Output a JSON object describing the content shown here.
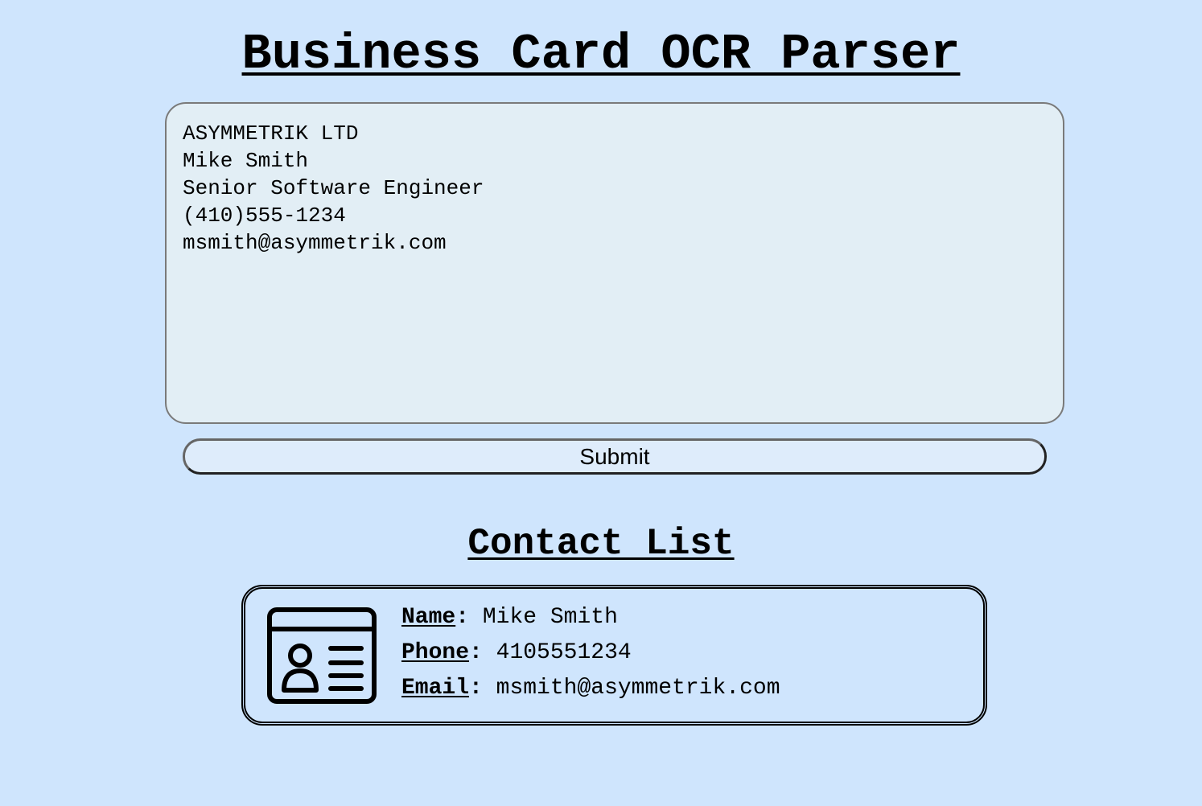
{
  "header": {
    "title": "Business Card OCR Parser"
  },
  "ocr_input": {
    "value": "ASYMMETRIK LTD\nMike Smith\nSenior Software Engineer\n(410)555-1234\nmsmith@asymmetrik.com"
  },
  "submit": {
    "label": "Submit"
  },
  "contacts": {
    "title": "Contact List",
    "items": [
      {
        "icon": "contact-card-icon",
        "name_label": "Name",
        "name": "Mike Smith",
        "phone_label": "Phone",
        "phone": "4105551234",
        "email_label": "Email",
        "email": "msmith@asymmetrik.com"
      }
    ]
  },
  "colors": {
    "background": "#cfe5fd",
    "textarea_background": "#e2eef5",
    "button_background": "#deecfb",
    "text": "#000000"
  }
}
